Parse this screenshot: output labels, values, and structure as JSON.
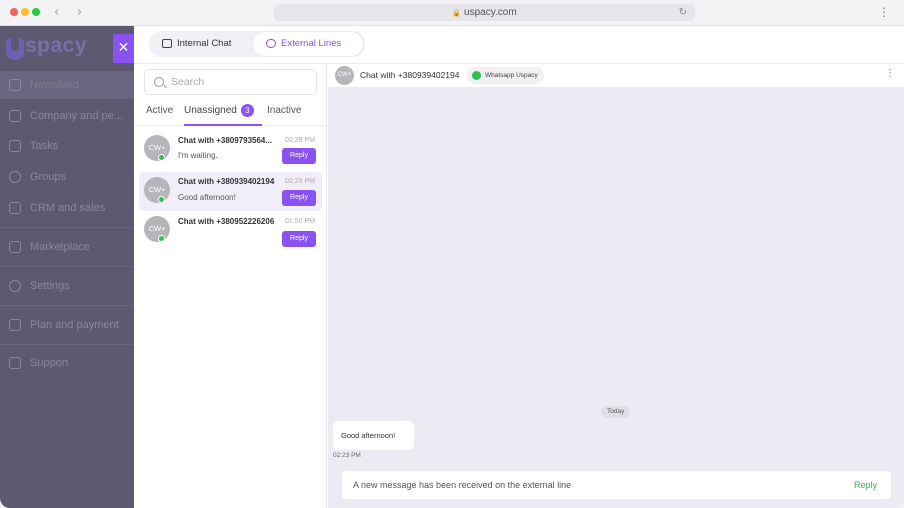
{
  "browser": {
    "url": "uspacy.com",
    "back_icon": "chevron-left-icon",
    "forward_icon": "chevron-right-icon"
  },
  "sidebar": {
    "logo": "spacy",
    "items": [
      {
        "label": "Newsfeed",
        "icon": "home-icon",
        "active": true
      },
      {
        "label": "Company and pe...",
        "icon": "building-icon"
      },
      {
        "label": "Tasks",
        "icon": "calendar-icon"
      },
      {
        "label": "Groups",
        "icon": "users-icon"
      },
      {
        "label": "CRM and sales",
        "icon": "database-icon"
      },
      {
        "label": "Marketplace",
        "icon": "store-icon"
      },
      {
        "label": "Settings",
        "icon": "gear-icon"
      },
      {
        "label": "Plan and payment",
        "icon": "wallet-icon"
      },
      {
        "label": "Support",
        "icon": "help-icon"
      }
    ]
  },
  "tabs": {
    "internal": "Internal Chat",
    "external": "External Lines"
  },
  "chatlist": {
    "search_placeholder": "Search",
    "filters": {
      "active": "Active",
      "unassigned": "Unassigned",
      "unassigned_count": "3",
      "inactive": "Inactive"
    },
    "chats": [
      {
        "avatar": "CW+",
        "name": "Chat with +3809793564...",
        "time": "02:29 PM",
        "message": "I'm waiting.",
        "reply": "Reply"
      },
      {
        "avatar": "CW+",
        "name": "Chat with +380939402194",
        "time": "02:23 PM",
        "message": "Good afternoon!",
        "reply": "Reply"
      },
      {
        "avatar": "CW+",
        "name": "Chat with +380952226206",
        "time": "01:50 PM",
        "message": "",
        "reply": "Reply"
      }
    ]
  },
  "chat": {
    "avatar": "CW+",
    "title": "Chat with +380939402194",
    "source": "Whatsapp Uspacy",
    "date_divider": "Today",
    "message": "Good afternoon!",
    "message_time": "02:23 PM",
    "notice": "A new message has been received on the external line",
    "notice_reply": "Reply"
  },
  "colors": {
    "accent": "#8a52f0",
    "online": "#2ec15a",
    "sidebar_bg": "#5e5870",
    "chat_bg": "#ecebf3"
  }
}
